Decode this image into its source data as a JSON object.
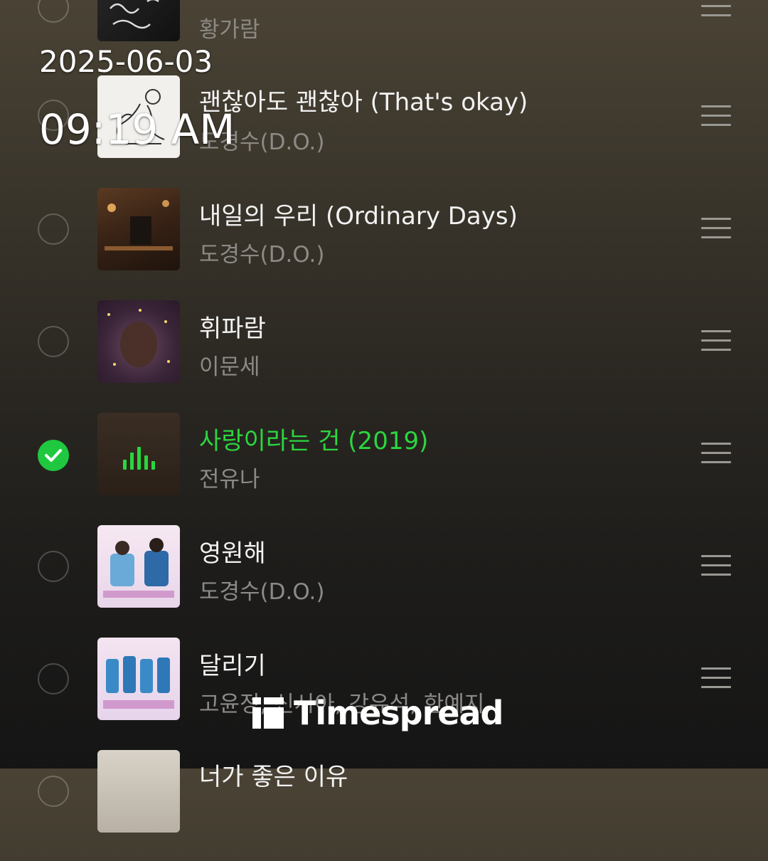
{
  "rows": [
    {
      "title": "",
      "artist": "황가람",
      "checked": false,
      "playing": false
    },
    {
      "title": "괜찮아도 괜찮아 (That's okay)",
      "artist": "도경수(D.O.)",
      "checked": false,
      "playing": false
    },
    {
      "title": "내일의 우리 (Ordinary Days)",
      "artist": "도경수(D.O.)",
      "checked": false,
      "playing": false
    },
    {
      "title": "휘파람",
      "artist": "이문세",
      "checked": false,
      "playing": false
    },
    {
      "title": "사랑이라는 건 (2019)",
      "artist": "전유나",
      "checked": true,
      "playing": true
    },
    {
      "title": "영원해",
      "artist": "도경수(D.O.)",
      "checked": false,
      "playing": false
    },
    {
      "title": "달리기",
      "artist": "고윤정, 신시아, 강유석, 한예지",
      "checked": false,
      "playing": false
    },
    {
      "title": "너가 좋은 이유",
      "artist": "",
      "checked": false,
      "playing": false
    }
  ],
  "overlay": {
    "date": "2025-06-03",
    "time": "09:19 AM",
    "watermark": "Timespread"
  },
  "colors": {
    "accent": "#2bd63e",
    "check": "#20c840",
    "title": "#f2f2f2",
    "artist": "#8c8a86"
  },
  "icons": [
    "checkbox-circle-icon",
    "check-icon",
    "drag-handle-icon",
    "equalizer-icon",
    "timespread-logo-icon"
  ]
}
